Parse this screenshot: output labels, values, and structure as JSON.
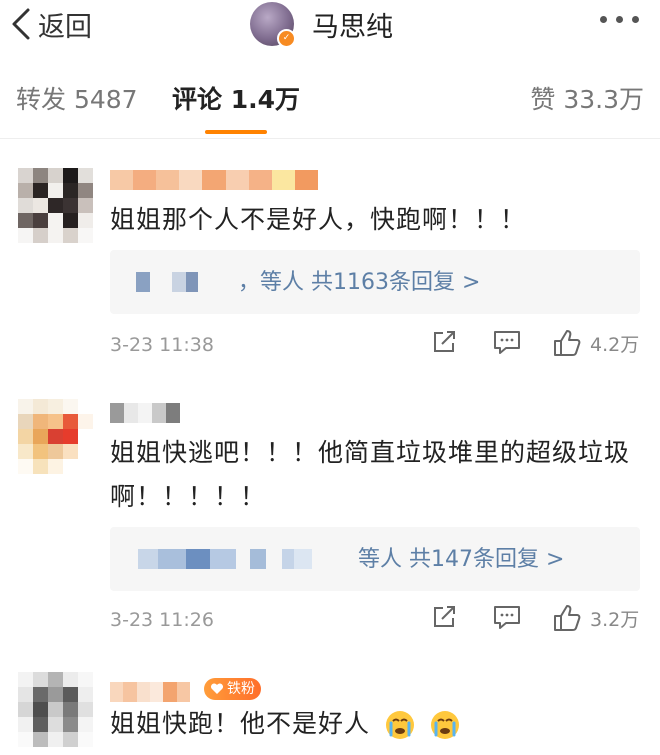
{
  "header": {
    "back_label": "返回",
    "profile_name": "马思纯"
  },
  "tabs": {
    "repost_label": "转发 5487",
    "comments_label": "评论 1.4万",
    "likes_label": "赞 33.3万"
  },
  "comments": [
    {
      "text": "姐姐那个人不是好人，快跑啊！！！",
      "reply_summary": "，等人 共1163条回复 >",
      "timestamp": "3-23 11:38",
      "like_count": "4.2万"
    },
    {
      "text": "姐姐快逃吧！！！他简直垃圾堆里的超级垃圾啊！！！！！",
      "reply_summary": "等人 共147条回复 >",
      "timestamp": "3-23 11:26",
      "like_count": "3.2万"
    },
    {
      "badge_label": "铁粉",
      "text": "姐姐快跑！他不是好人"
    }
  ],
  "icons": {
    "back": "chevron-left-icon",
    "more": "more-dots-icon",
    "share": "share-icon",
    "reply": "comment-icon",
    "like": "thumbs-up-icon",
    "emoji": "crying-face-emoji"
  },
  "colors": {
    "accent": "#ff8200",
    "link": "#5d7fa6",
    "meta": "#999999"
  }
}
